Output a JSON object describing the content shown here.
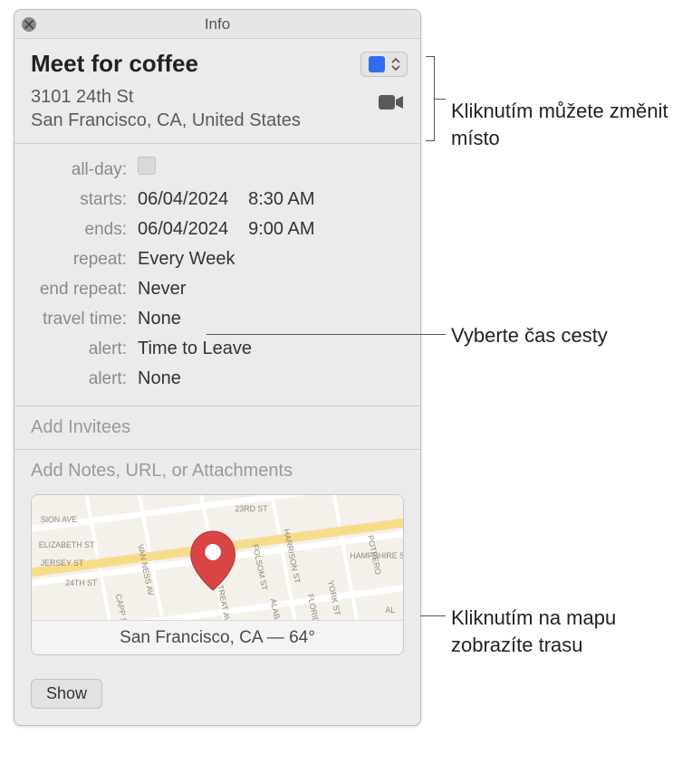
{
  "titlebar": {
    "title": "Info"
  },
  "event": {
    "title": "Meet for coffee",
    "location_line1": "3101 24th St",
    "location_line2": "San Francisco, CA, United States"
  },
  "fields": {
    "allday_label": "all-day:",
    "starts_label": "starts:",
    "starts_date": "06/04/2024",
    "starts_time": "8:30 AM",
    "ends_label": "ends:",
    "ends_date": "06/04/2024",
    "ends_time": "9:00 AM",
    "repeat_label": "repeat:",
    "repeat_value": "Every Week",
    "endrepeat_label": "end repeat:",
    "endrepeat_value": "Never",
    "travel_label": "travel time:",
    "travel_value": "None",
    "alert1_label": "alert:",
    "alert1_value": "Time to Leave",
    "alert2_label": "alert:",
    "alert2_value": "None"
  },
  "invitees_placeholder": "Add Invitees",
  "notes_placeholder": "Add Notes, URL, or Attachments",
  "map": {
    "footer": "San Francisco, CA — 64°",
    "streets": {
      "s1": "23RD ST",
      "s2": "24TH ST",
      "s3": "SION AVE",
      "s4": "ELIZABETH ST",
      "s5": "JERSEY ST",
      "s6": "TREAT AVE",
      "s7": "HARRISON ST",
      "s8": "VAN NESS AV",
      "s9": "CAPP ST",
      "s10": "POTRERO",
      "s11": "YORK ST",
      "s12": "HAMPSHIRE S",
      "s13": "FLORIDA ST",
      "s14": "ALABAMA S",
      "s15": "FOLSOM ST",
      "s16": "AL"
    }
  },
  "show_button": "Show",
  "callouts": {
    "location": "Kliknutím můžete změnit místo",
    "travel": "Vyberte čas cesty",
    "map": "Kliknutím na mapu zobrazíte trasu"
  }
}
